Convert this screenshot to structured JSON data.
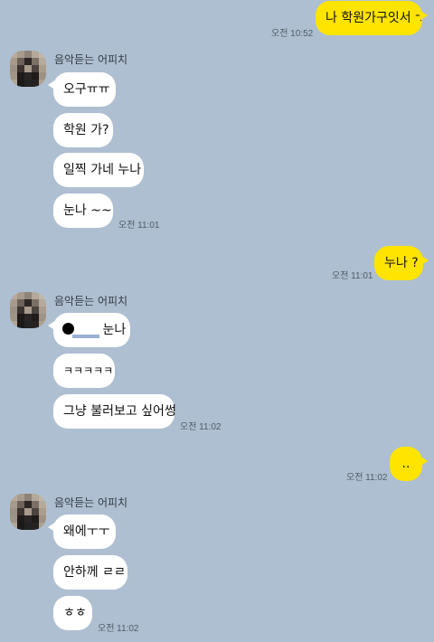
{
  "colors": {
    "background": "#aebfd1",
    "my_bubble": "#ffe400",
    "their_bubble": "#ffffff"
  },
  "contact": {
    "name": "음악듣는 어피치"
  },
  "messages": {
    "m1": {
      "text": "나 학원가구잇서 ㅜ",
      "time": "오전 10:52"
    },
    "m2": {
      "text": "오구ㅠㅠ"
    },
    "m3": {
      "text": "학원 가?"
    },
    "m4": {
      "text": "일찍 가네 누나"
    },
    "m5": {
      "text": "눈나 ~~",
      "time": "오전 11:01"
    },
    "m6": {
      "text": "누나 ?",
      "time": "오전 11:01"
    },
    "m7": {
      "text": "눈나"
    },
    "m8": {
      "text": "ㅋㅋㅋㅋㅋ"
    },
    "m9": {
      "text": "그냥 불러보고 싶어썽",
      "time": "오전 11:02"
    },
    "m10": {
      "text": "..",
      "time": "오전 11:02"
    },
    "m11": {
      "text": "왜에ㅜㅜ"
    },
    "m12": {
      "text": "안하께 ㄹㄹ"
    },
    "m13": {
      "text": "ㅎㅎ",
      "time": "오전 11:02"
    }
  }
}
